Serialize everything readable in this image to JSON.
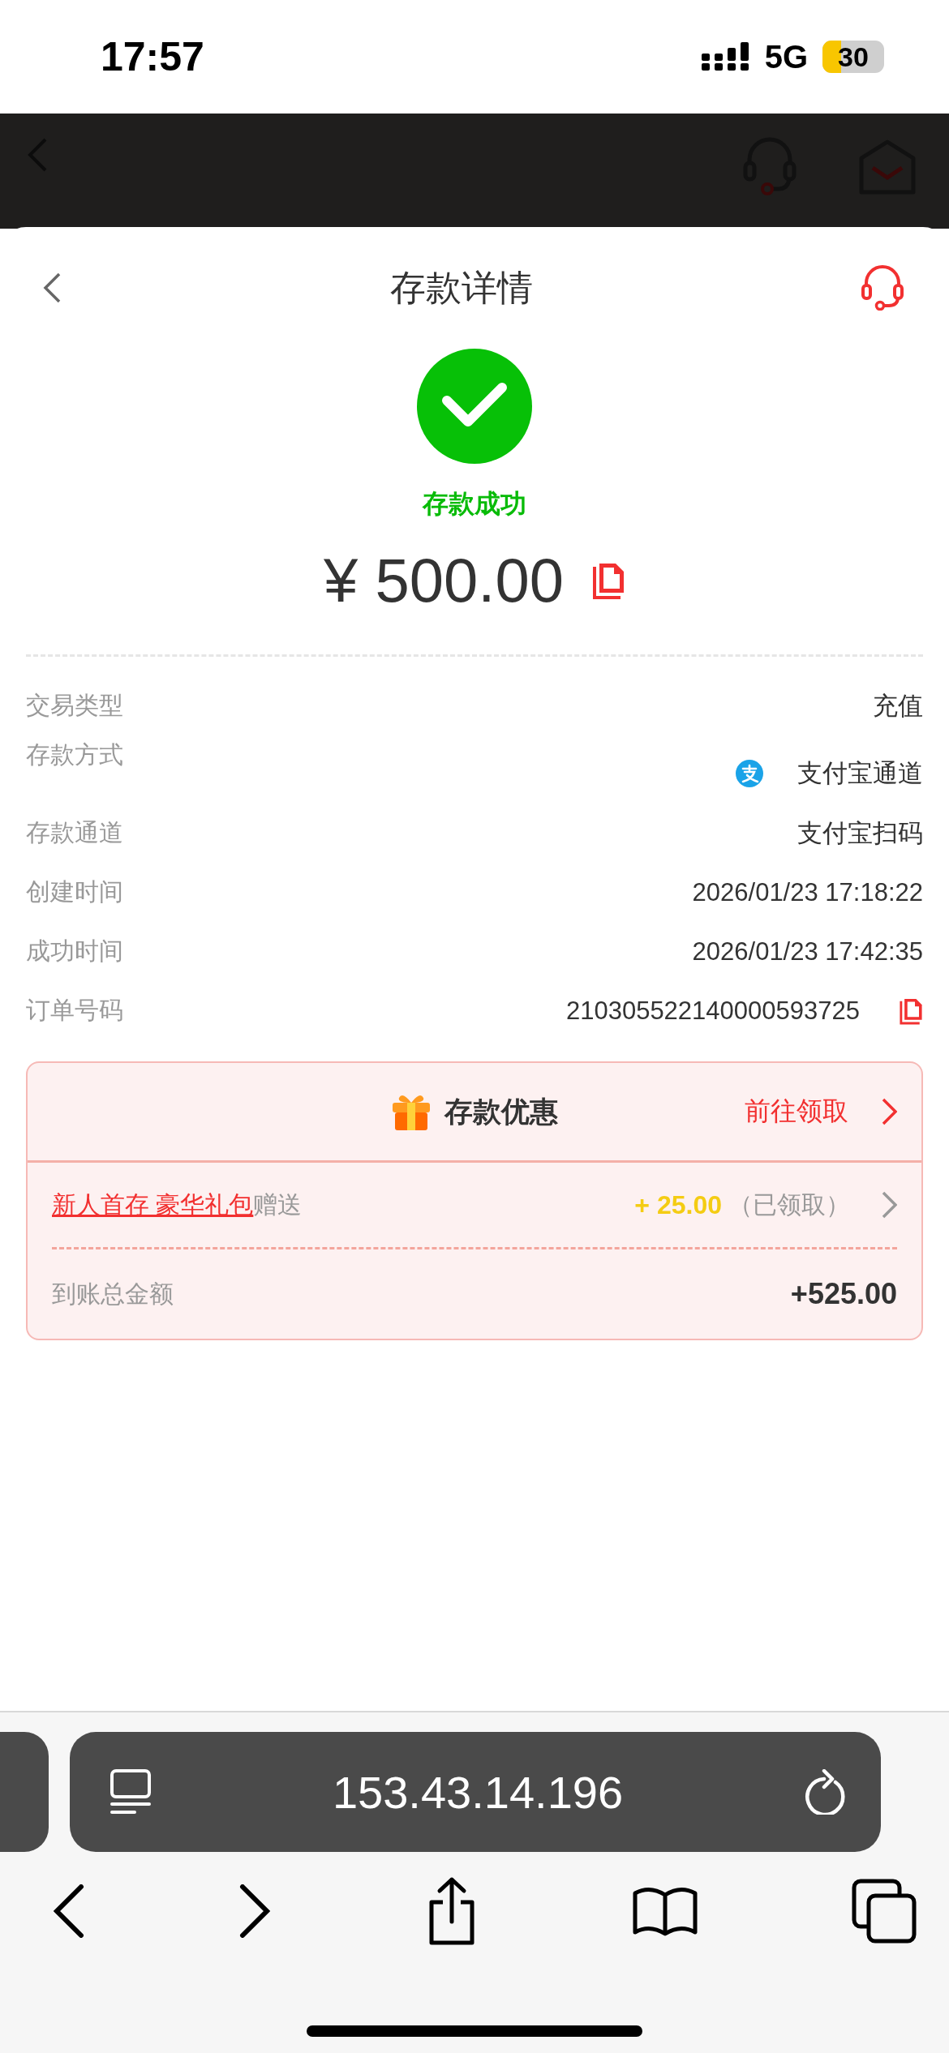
{
  "status_bar": {
    "time": "17:57",
    "network": "5G",
    "battery": "30"
  },
  "sheet": {
    "title": "存款详情",
    "status": "存款成功",
    "amount": "¥ 500.00"
  },
  "details": [
    {
      "label": "交易类型",
      "value": "充值",
      "kind": "text"
    },
    {
      "label": "存款方式",
      "value": "支付宝通道",
      "kind": "alipay"
    },
    {
      "label": "存款通道",
      "value": "支付宝扫码",
      "kind": "text"
    },
    {
      "label": "创建时间",
      "value": "2026/01/23 17:18:22",
      "kind": "text"
    },
    {
      "label": "成功时间",
      "value": "2026/01/23 17:42:35",
      "kind": "text"
    },
    {
      "label": "订单号码",
      "value": "210305522140000593725",
      "kind": "copy"
    }
  ],
  "promo": {
    "title": "存款优惠",
    "action": "前往领取",
    "gift_link": "新人首存 豪华礼包",
    "gift_suffix": "赠送",
    "gift_amount": "+ 25.00",
    "gift_status": "（已领取）",
    "total_label": "到账总金额",
    "total_value": "+525.00"
  },
  "browser": {
    "url": "153.43.14.196"
  }
}
